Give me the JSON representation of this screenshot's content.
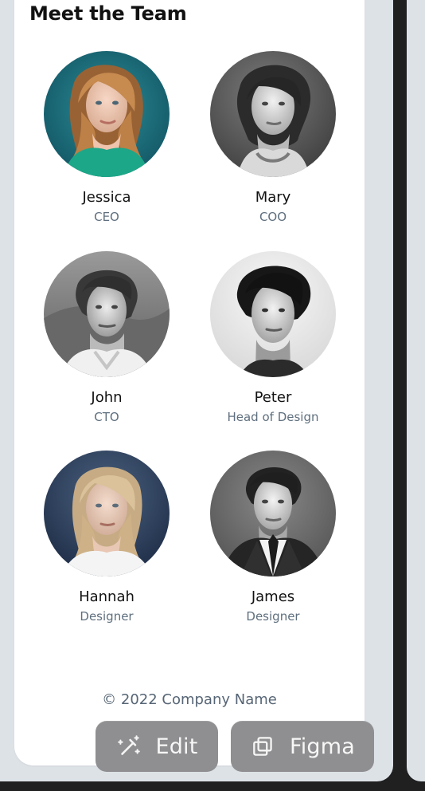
{
  "page": {
    "title": "Meet the Team",
    "footer": "© 2022 Company Name"
  },
  "team": [
    {
      "name": "Jessica",
      "role": "CEO",
      "avatar": "portrait-jessica"
    },
    {
      "name": "Mary",
      "role": "COO",
      "avatar": "portrait-mary"
    },
    {
      "name": "John",
      "role": "CTO",
      "avatar": "portrait-john"
    },
    {
      "name": "Peter",
      "role": "Head of Design",
      "avatar": "portrait-peter"
    },
    {
      "name": "Hannah",
      "role": "Designer",
      "avatar": "portrait-hannah"
    },
    {
      "name": "James",
      "role": "Designer",
      "avatar": "portrait-james"
    }
  ],
  "actions": {
    "edit": {
      "label": "Edit",
      "icon": "magic-wand-icon"
    },
    "figma": {
      "label": "Figma",
      "icon": "copy-frame-icon"
    }
  },
  "colors": {
    "background": "#202020",
    "panel": "#dde2e7",
    "card": "#ffffff",
    "text": "#121212",
    "muted": "#5f6f7e",
    "button": "#8f8f91"
  }
}
